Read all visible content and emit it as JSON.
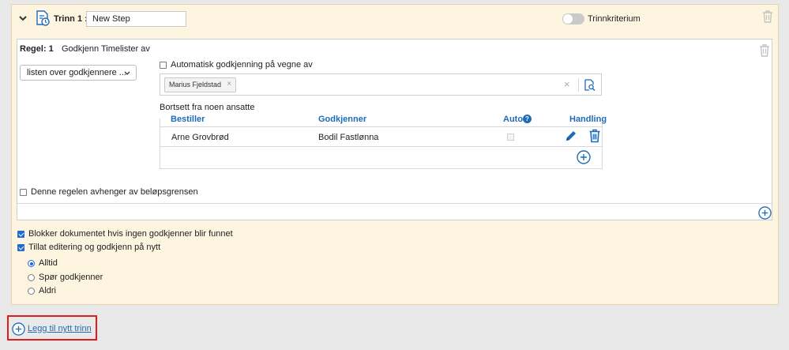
{
  "step": {
    "label": "Trinn 1 :",
    "name_value": "New Step",
    "toggle_label": "Trinnkriterium",
    "toggle_on": false
  },
  "rule": {
    "number_label": "Regel: 1",
    "title": "Godkjenn Timelister av",
    "approver_select": "listen over godkjennere ...",
    "auto_approve_label": "Automatisk godkjenning på vegne av",
    "auto_approve_checked": false,
    "tags": [
      "Marius Fjeldstad"
    ],
    "clear_symbol": "×",
    "exclude_label": "Bortsett fra noen ansatte",
    "table": {
      "headers": {
        "orderer": "Bestiller",
        "approver": "Godkjenner",
        "auto": "Auto",
        "action": "Handling"
      },
      "help_symbol": "?",
      "rows": [
        {
          "orderer": "Arne Grovbrød",
          "approver": "Bodil Fastlønna",
          "auto": false
        }
      ]
    },
    "amount_dependent_label": "Denne regelen avhenger av beløpsgrensen",
    "amount_dependent_checked": false
  },
  "options": {
    "block_label": "Blokker dokumentet hvis ingen godkjenner blir funnet",
    "block_checked": true,
    "allow_edit_label": "Tillat editering og godkjenn på nytt",
    "allow_edit_checked": true,
    "radios": [
      {
        "label": "Alltid",
        "checked": true
      },
      {
        "label": "Spør godkjenner",
        "checked": false
      },
      {
        "label": "Aldri",
        "checked": false
      }
    ]
  },
  "add_step_label": "Legg til nytt trinn",
  "colors": {
    "accent": "#1f6bb5",
    "step_background": "#fdf5df",
    "highlight_border": "#e01b1b"
  }
}
